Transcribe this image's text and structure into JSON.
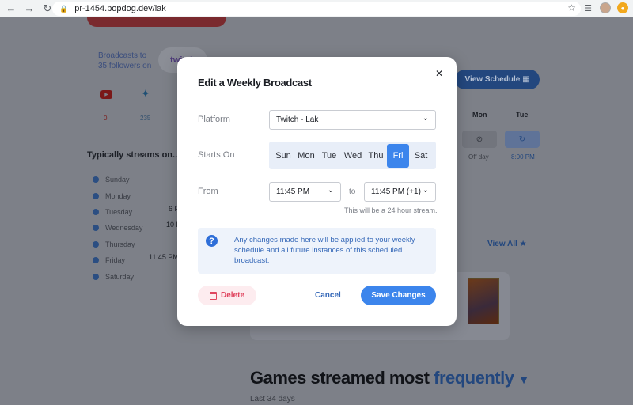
{
  "browser": {
    "url": "pr-1454.popdog.dev/lak"
  },
  "background": {
    "broadcasts_text_line1": "Broadcasts to",
    "broadcasts_text_line2": "35 followers on",
    "youtube_count": "0",
    "twitter_count": "235",
    "typically_streams": "Typically streams on...",
    "days": [
      {
        "name": "Sunday",
        "time": ""
      },
      {
        "name": "Monday",
        "time": ""
      },
      {
        "name": "Tuesday",
        "time": "6 P"
      },
      {
        "name": "Wednesday",
        "time": "10 P"
      },
      {
        "name": "Thursday",
        "time": ""
      },
      {
        "name": "Friday",
        "time": "11:45 PM"
      },
      {
        "name": "Saturday",
        "time": ""
      }
    ],
    "view_schedule": "View Schedule",
    "schedule_headers": [
      "Mon",
      "Tue"
    ],
    "schedule_labels": [
      "Off day",
      "8:00 PM"
    ],
    "view_all": "View All",
    "games_title_plain": "Games streamed most",
    "games_title_accent": "frequently",
    "last_days": "Last 34 days",
    "colors": {
      "accent": "#23477e",
      "youtube": "#7a1818"
    }
  },
  "modal": {
    "title": "Edit a Weekly Broadcast",
    "close_icon": "close-icon",
    "platform_label": "Platform",
    "platform_value": "Twitch - Lak",
    "starts_on_label": "Starts On",
    "days": [
      "Sun",
      "Mon",
      "Tue",
      "Wed",
      "Thu",
      "Fri",
      "Sat"
    ],
    "selected_day": "Fri",
    "from_label": "From",
    "from_value": "11:45 PM",
    "to_label": "to",
    "to_value": "11:45 PM (+1)",
    "hint": "This will be a 24 hour stream.",
    "info_text": "Any changes made here will be applied to your weekly schedule and all future instances of this scheduled broadcast.",
    "delete_label": "Delete",
    "cancel_label": "Cancel",
    "save_label": "Save Changes",
    "colors": {
      "primary": "#3c85ec",
      "danger": "#e0455f",
      "info_bg": "#eef3fb"
    }
  }
}
